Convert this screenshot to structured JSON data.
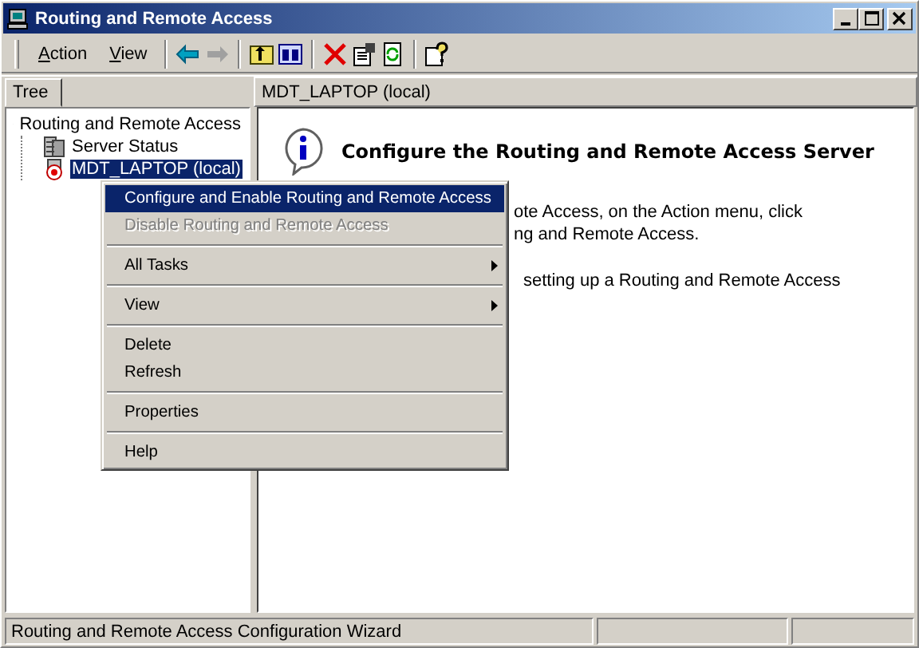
{
  "window": {
    "title": "Routing and Remote Access"
  },
  "menu_bar": [
    {
      "label": "Action"
    },
    {
      "label": "View"
    }
  ],
  "tree_tab": {
    "label": "Tree"
  },
  "tree": [
    {
      "label": "Routing and Remote Access",
      "selected": false,
      "children": [
        {
          "label": "Server Status",
          "selected": false
        },
        {
          "label": "MDT_LAPTOP (local)",
          "selected": true
        }
      ]
    }
  ],
  "detail": {
    "header": "MDT_LAPTOP (local)",
    "heading": "Configure the Routing and Remote Access Server",
    "paragraphs": [
      [
        "ote Access, on the Action menu, click",
        "ng and Remote Access."
      ],
      [
        "setting up a Routing and Remote Access"
      ]
    ]
  },
  "context_menu": [
    {
      "kind": "item",
      "label": "Configure and Enable Routing and Remote Access",
      "selected": true,
      "disabled": false,
      "submenu": false
    },
    {
      "kind": "item",
      "label": "Disable Routing and Remote Access",
      "selected": false,
      "disabled": true,
      "submenu": false
    },
    {
      "kind": "separator"
    },
    {
      "kind": "item",
      "label": "All Tasks",
      "selected": false,
      "disabled": false,
      "submenu": true
    },
    {
      "kind": "separator"
    },
    {
      "kind": "item",
      "label": "View",
      "selected": false,
      "disabled": false,
      "submenu": true
    },
    {
      "kind": "separator"
    },
    {
      "kind": "item",
      "label": "Delete",
      "selected": false,
      "disabled": false,
      "submenu": false
    },
    {
      "kind": "item",
      "label": "Refresh",
      "selected": false,
      "disabled": false,
      "submenu": false
    },
    {
      "kind": "separator"
    },
    {
      "kind": "item",
      "label": "Properties",
      "selected": false,
      "disabled": false,
      "submenu": false
    },
    {
      "kind": "separator"
    },
    {
      "kind": "item",
      "label": "Help",
      "selected": false,
      "disabled": false,
      "submenu": false
    }
  ],
  "status_bar": {
    "text": "Routing and Remote Access Configuration Wizard"
  }
}
